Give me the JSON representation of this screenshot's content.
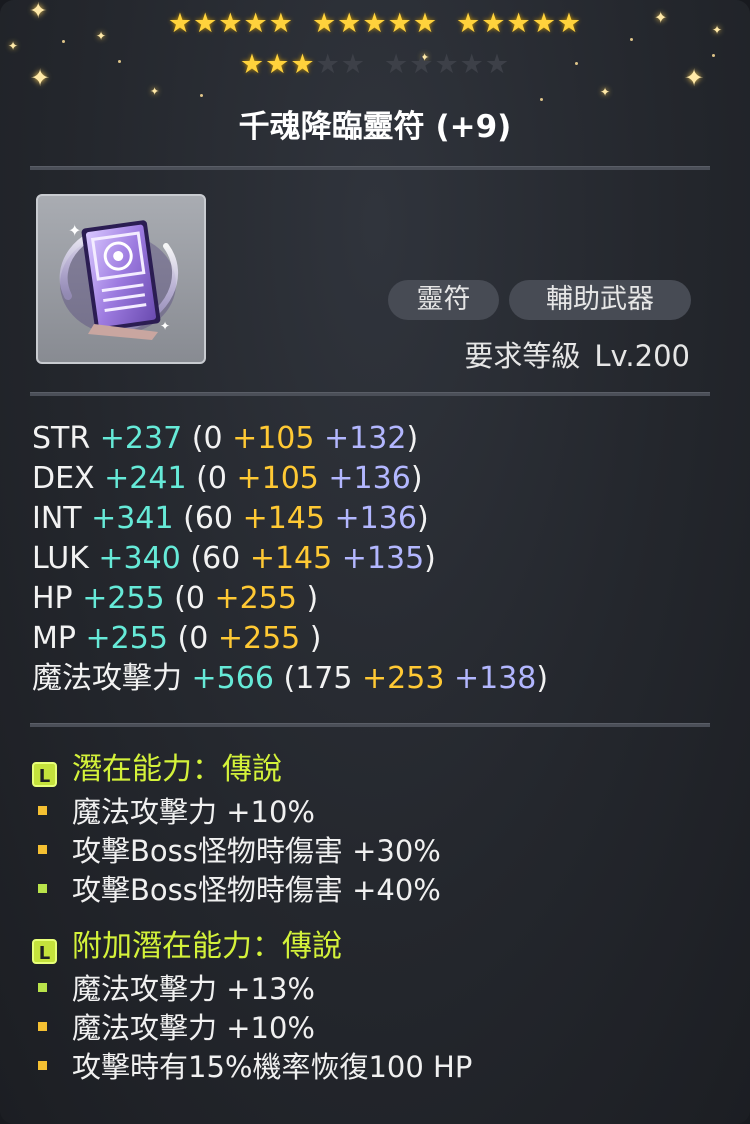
{
  "item": {
    "name": "千魂降臨靈符 (+9)",
    "stars_total": 25,
    "stars_filled": 18,
    "category_tags": [
      "靈符",
      "輔助武器"
    ],
    "required_level_label": "要求等級",
    "required_level_value": "Lv.200"
  },
  "stats": [
    {
      "name": "STR",
      "total": "+237",
      "open": "(",
      "base": "0",
      "bonus": "+105",
      "enhance": "+132",
      "close": ")"
    },
    {
      "name": "DEX",
      "total": "+241",
      "open": "(",
      "base": "0",
      "bonus": "+105",
      "enhance": "+136",
      "close": ")"
    },
    {
      "name": "INT",
      "total": "+341",
      "open": "(",
      "base": "60",
      "bonus": "+145",
      "enhance": "+136",
      "close": ")"
    },
    {
      "name": "LUK",
      "total": "+340",
      "open": "(",
      "base": "60",
      "bonus": "+145",
      "enhance": "+135",
      "close": ")"
    },
    {
      "name": "HP",
      "total": "+255",
      "open": "(",
      "base": "0",
      "bonus": "+255",
      "close": ")"
    },
    {
      "name": "MP",
      "total": "+255",
      "open": "(",
      "base": "0",
      "bonus": "+255",
      "close": ")"
    },
    {
      "name": "魔法攻擊力",
      "total": "+566",
      "open": "(",
      "base": "175",
      "bonus": "+253",
      "enhance": "+138",
      "close": ")"
    }
  ],
  "potential": {
    "badge": "L",
    "title": "潛在能力：傳說",
    "lines": [
      {
        "text": "魔法攻擊力 +10%",
        "bullet_color": "#f5c032"
      },
      {
        "text": "攻擊Boss怪物時傷害 +30%",
        "bullet_color": "#f5c032"
      },
      {
        "text": "攻擊Boss怪物時傷害 +40%",
        "bullet_color": "#b9e34a"
      }
    ]
  },
  "additional_potential": {
    "badge": "L",
    "title": "附加潛在能力：傳說",
    "lines": [
      {
        "text": "魔法攻擊力 +13%",
        "bullet_color": "#b9e34a"
      },
      {
        "text": "魔法攻擊力 +10%",
        "bullet_color": "#f5c032"
      },
      {
        "text": "攻擊時有15%機率恢復100 HP",
        "bullet_color": "#f5c032"
      }
    ]
  },
  "colors": {
    "background": "#24272d",
    "star_filled": "#ffd23c",
    "star_empty": "#3d4048",
    "stat_total": "#66ead8",
    "stat_bonus": "#ffc934",
    "stat_enhance": "#b3b7ff",
    "potential_title": "#d4f23a"
  },
  "icons": {
    "item_icon": "talisman-icon",
    "star": "star-icon",
    "grade_badge": "legendary-grade-icon",
    "sparkle": "sparkle-icon"
  }
}
